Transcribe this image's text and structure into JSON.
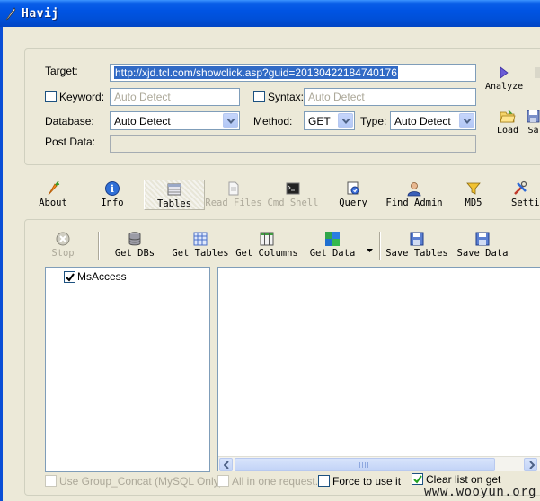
{
  "window": {
    "title": "Havij"
  },
  "form": {
    "target_label": "Target:",
    "target_value": "http://xjd.tcl.com/showclick.asp?guid=20130422184740176",
    "keyword_label": "Keyword:",
    "keyword_placeholder": "Auto Detect",
    "syntax_label": "Syntax:",
    "syntax_placeholder": "Auto Detect",
    "database_label": "Database:",
    "database_value": "Auto Detect",
    "method_label": "Method:",
    "method_value": "GET",
    "type_label": "Type:",
    "type_value": "Auto Detect",
    "postdata_label": "Post Data:"
  },
  "side_buttons": {
    "analyze": "Analyze",
    "load": "Load",
    "save": "Sa"
  },
  "toolbar": [
    {
      "label": "About"
    },
    {
      "label": "Info"
    },
    {
      "label": "Tables"
    },
    {
      "label": "Read Files"
    },
    {
      "label": "Cmd Shell"
    },
    {
      "label": "Query"
    },
    {
      "label": "Find Admin"
    },
    {
      "label": "MD5"
    },
    {
      "label": "Setti"
    }
  ],
  "table_toolbar": [
    {
      "label": "Stop"
    },
    {
      "label": "Get DBs"
    },
    {
      "label": "Get Tables"
    },
    {
      "label": "Get Columns"
    },
    {
      "label": "Get Data"
    },
    {
      "label": "Save Tables"
    },
    {
      "label": "Save Data"
    }
  ],
  "tree": {
    "nodes": [
      {
        "label": "MsAccess",
        "checked": true
      }
    ]
  },
  "options": {
    "group_concat": "Use Group_Concat (MySQL Only)",
    "all_in_one": "All in one request.",
    "force": "Force to use it",
    "clear_list": "Clear list on get"
  },
  "watermark": "www.wooyun.org",
  "colors": {
    "titlebar": "#0054e3",
    "selection": "#316ac5",
    "face": "#ece9d8"
  }
}
